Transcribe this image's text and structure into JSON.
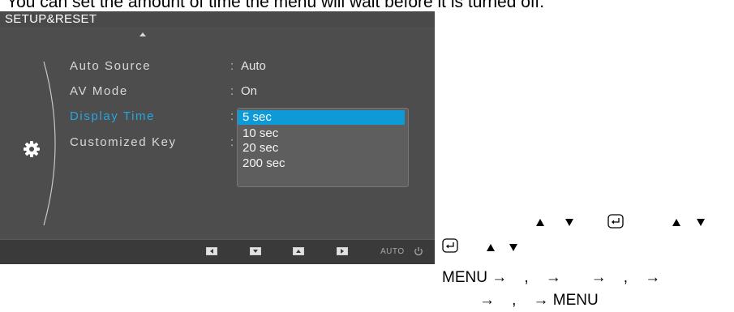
{
  "caption": "You can set the amount of time the menu will wait before it is turned off.",
  "osd": {
    "title": "SETUP&RESET",
    "items": [
      {
        "label": "Auto Source",
        "value": "Auto"
      },
      {
        "label": "AV Mode",
        "value": "On"
      },
      {
        "label": "Display Time",
        "value": ""
      },
      {
        "label": "Customized Key",
        "value": ""
      }
    ],
    "separator": ":",
    "dropdown": {
      "options": [
        "5 sec",
        "10 sec",
        "20 sec",
        "200 sec"
      ],
      "selected": "5 sec"
    },
    "footer": {
      "buttons": [
        "left-arrow-icon",
        "down-arrow-icon",
        "up-arrow-icon",
        "right-arrow-icon"
      ],
      "auto_label": "AUTO",
      "power": "power-icon"
    },
    "colors": {
      "highlight": "#0d9ad6",
      "selected_text": "#27a6dd",
      "background": "#4d4d4d"
    }
  },
  "instructions": {
    "line1": "MENU →    ,    →       →    ,    →",
    "line2": "→    ,    → MENU"
  }
}
